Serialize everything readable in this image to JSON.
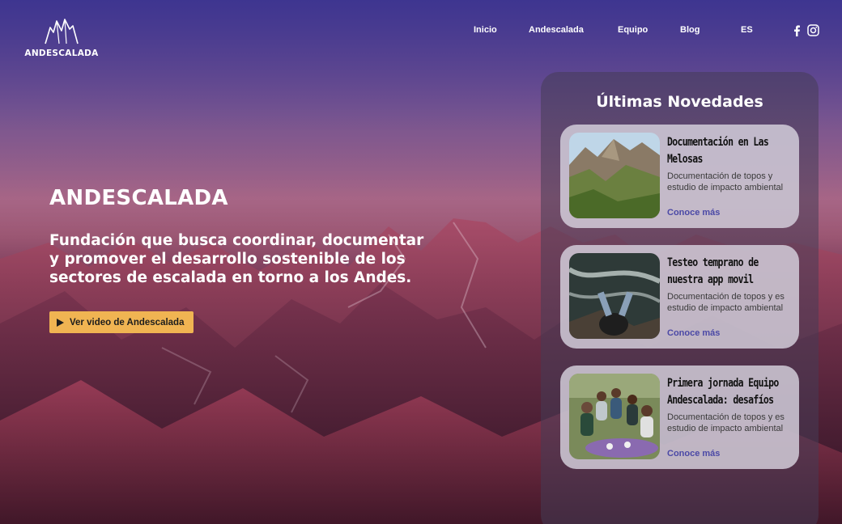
{
  "brand": {
    "name": "ANDESCALADA"
  },
  "nav": {
    "items": [
      {
        "label": "Inicio"
      },
      {
        "label": "Andescalada"
      },
      {
        "label": "Equipo"
      },
      {
        "label": "Blog"
      },
      {
        "label": "ES"
      }
    ],
    "social": [
      "facebook-icon",
      "instagram-icon"
    ]
  },
  "hero": {
    "title": "ANDESCALADA",
    "description": "Fundación que busca coordinar, documentar y promover el desarrollo sostenible de los sectores de escalada en torno a los Andes.",
    "video_button": "Ver video de Andescalada"
  },
  "news": {
    "title": "Últimas Novedades",
    "cards": [
      {
        "title": "Documentación en Las Melosas",
        "description": "Documentación de topos y estudio de impacto ambiental",
        "link": "Conoce más"
      },
      {
        "title": "Testeo temprano de nuestra app movil",
        "description": "Documentación de topos y es estudio de impacto ambiental",
        "link": "Conoce más"
      },
      {
        "title": "Primera jornada Equipo Andescalada: desafíos",
        "description": "Documentación de topos y es estudio de impacto ambiental",
        "link": "Conoce más"
      }
    ]
  },
  "colors": {
    "accent": "#f0b452",
    "link": "#4b49a6"
  }
}
